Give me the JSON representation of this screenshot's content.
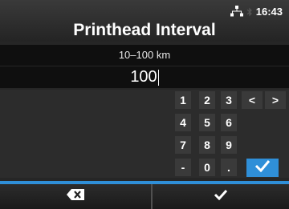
{
  "header": {
    "title": "Printhead Interval",
    "time": "16:43"
  },
  "field": {
    "range": "10–100 km",
    "value": "100"
  },
  "keypad": {
    "keys": [
      "1",
      "2",
      "3",
      "<",
      ">",
      "4",
      "5",
      "6",
      "7",
      "8",
      "9",
      "-",
      "0",
      "."
    ]
  },
  "footer": {
    "left_icon": "backspace-icon",
    "right_icon": "check-icon"
  },
  "colors": {
    "accent": "#2f8fd8",
    "background": "#262626"
  }
}
